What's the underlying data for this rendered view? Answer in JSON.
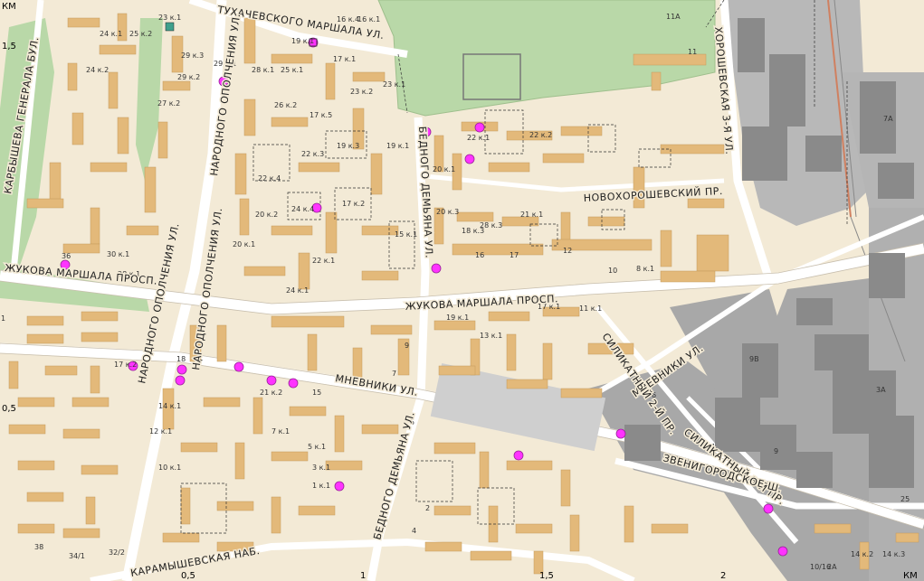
{
  "map": {
    "colors": {
      "background": "#f3ead6",
      "building": "#e3b97a",
      "industrial": "#a8a8a8",
      "industrial_building": "#8a8a8a",
      "park": "#b9d8a8",
      "road": "#ffffff",
      "poi": "#ff33ff"
    },
    "streets": {
      "tukhachevskogo": "ТУХАЧЕВСКОГО МАРШАЛА УЛ.",
      "karbysheva": "КАРБЫШЕВА ГЕНЕРАЛА БУЛ.",
      "narodnogo_opolcheniya_top": "НАРОДНОГО ОПОЛЧЕНИЯ УЛ.",
      "narodnogo_opolcheniya_mid": "НАРОДНОГО ОПОЛЧЕНИЯ УЛ.",
      "narodnogo_opolcheniya_bottom": "НАРОДНОГО ОПОЛЧЕНИЯ УЛ.",
      "zhukova_left": "ЖУКОВА МАРШАЛА ПРОСП.",
      "zhukova_right": "ЖУКОВА МАРШАЛА ПРОСП.",
      "bednogo_top": "БЕДНОГО ДЕМЬЯНА УЛ.",
      "bednogo_bottom": "БЕДНОГО ДЕМЬЯНА УЛ.",
      "novokhoroshevsky": "НОВОХОРОШЕВСКИЙ ПР.",
      "khoroshevskaya": "ХОРОШЕВСКАЯ 3-Я УЛ.",
      "mnevniki": "МНЕВНИКИ УЛ.",
      "mnevniki_right": "МНЕВНИКИ УЛ.",
      "silikatny2": "СИЛИКАТНЫЙ 2-Й ПР.",
      "silikatny3": "СИЛИКАТНЫЙ 3-Й ПР.",
      "zvenigorodskoe": "ЗВЕНИГОРОДСКОЕ Ш.",
      "karamyshevskaya": "КАРАМЫШЕВСКАЯ НАБ."
    },
    "scale_labels": {
      "left_top": "1,5",
      "left_mid": "0,5",
      "bottom_05": "0,5",
      "bottom_1": "1",
      "bottom_15": "1,5",
      "bottom_2": "2",
      "km_top": "КМ",
      "km_bottom": "КМ"
    },
    "building_numbers": [
      "23 к.1",
      "19 к.1",
      "16 к.4",
      "16 к.1",
      "24 к.1",
      "24 к.2",
      "25 к.2",
      "29 к.3",
      "29 к.2",
      "29 к.1",
      "27 к.2",
      "28 к.1",
      "17 к.1",
      "17 к.5",
      "23 к.1",
      "23 к.2",
      "25 к.1",
      "26 к.2",
      "19 к.3",
      "22 к.3",
      "22 к.4",
      "20 к.2",
      "24 к.4",
      "17 к.2",
      "19 к.1",
      "20 к.1",
      "22 к.1",
      "22 к.2",
      "20 к.3",
      "21 к.1",
      "28 к.3",
      "18 к.3",
      "15 к.1",
      "16",
      "17",
      "12",
      "10",
      "8 к.1",
      "36",
      "30 к.1",
      "28 к.1",
      "24 к.1",
      "22 к.1",
      "20 к.1",
      "19 к.1",
      "17 к.1",
      "13 к.1",
      "11 к.1",
      "17 к.2",
      "18",
      "27",
      "21 к.2",
      "15",
      "14 к.1",
      "12 к.1",
      "10 к.1",
      "9",
      "7",
      "5",
      "3",
      "1",
      "4",
      "2",
      "11",
      "11А",
      "7А",
      "9В",
      "25",
      "34",
      "6",
      "9",
      "3А",
      "2А",
      "10/16",
      "14 к.2",
      "14 к.3",
      "38",
      "34/1",
      "32/2",
      "5 к.1",
      "7 к.1",
      "3 к.1",
      "1 к.1"
    ],
    "poi_count": 22
  }
}
